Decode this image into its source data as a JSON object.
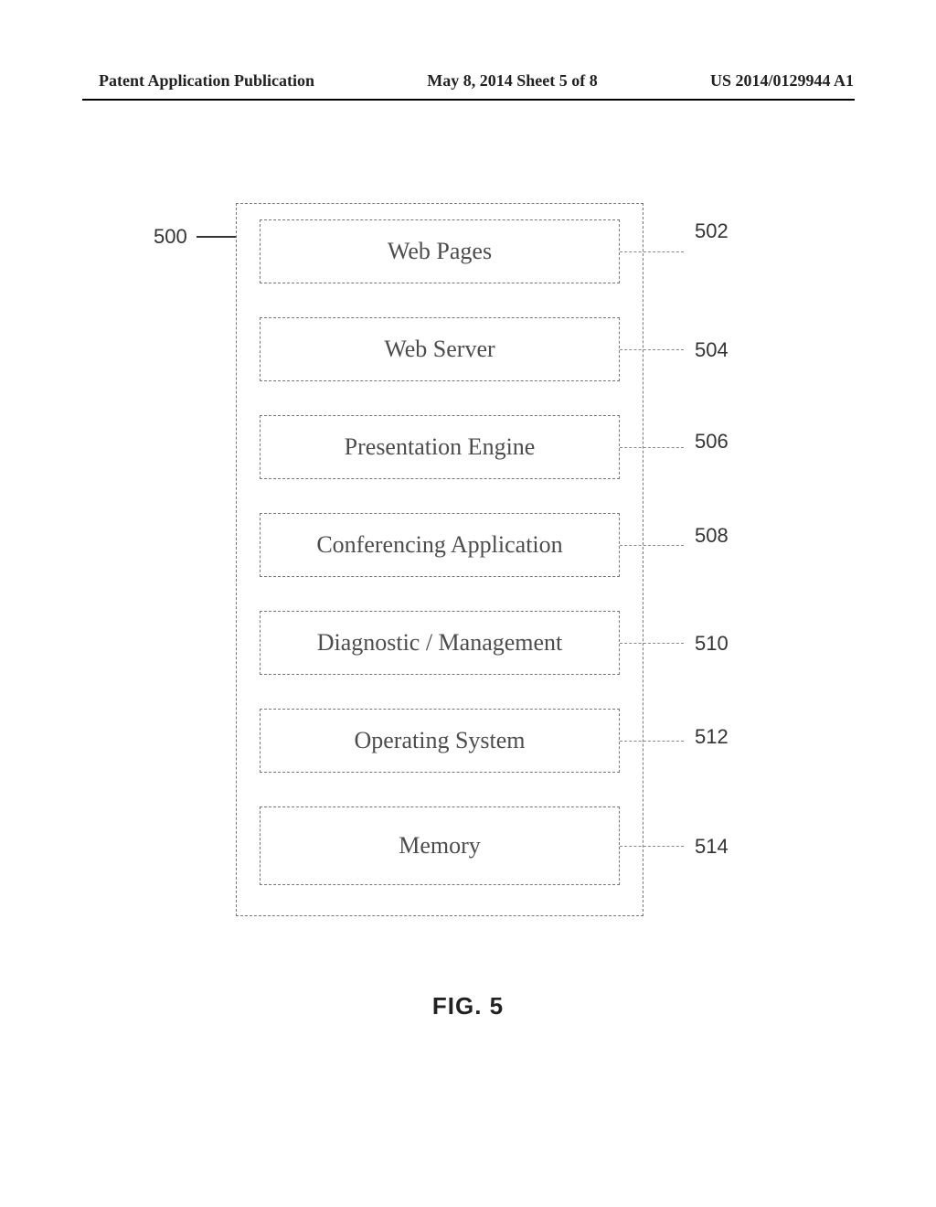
{
  "header": {
    "left": "Patent Application Publication",
    "center": "May 8, 2014  Sheet 5 of 8",
    "right": "US 2014/0129944 A1"
  },
  "figure": {
    "caption": "FIG. 5",
    "container_ref": "500",
    "boxes": [
      {
        "label": "Web Pages",
        "ref": "502"
      },
      {
        "label": "Web Server",
        "ref": "504"
      },
      {
        "label": "Presentation Engine",
        "ref": "506"
      },
      {
        "label": "Conferencing Application",
        "ref": "508"
      },
      {
        "label": "Diagnostic / Management",
        "ref": "510"
      },
      {
        "label": "Operating System",
        "ref": "512"
      },
      {
        "label": "Memory",
        "ref": "514"
      }
    ]
  }
}
